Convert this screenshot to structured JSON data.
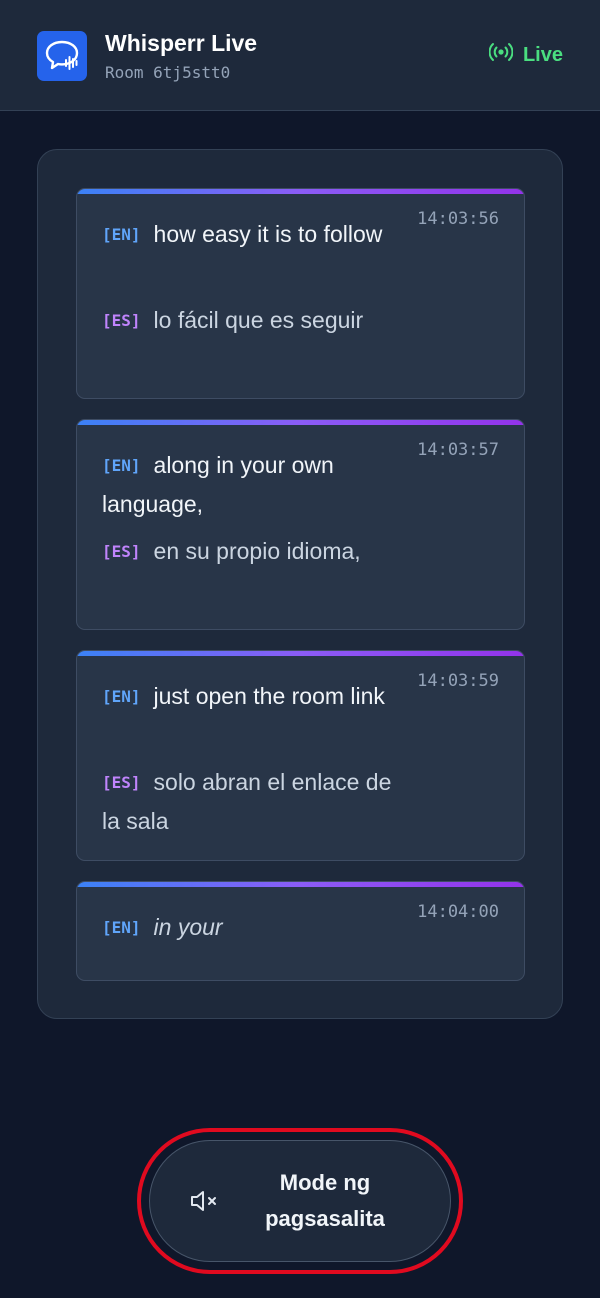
{
  "header": {
    "title": "Whisperr Live",
    "room": "Room 6tj5stt0",
    "status": "Live",
    "status_color": "#4ade80",
    "icon": "chat-bubble-waveform-icon"
  },
  "transcript": [
    {
      "time": "14:03:56",
      "en_tag": "[EN]",
      "en_text": "how easy it is to follow",
      "es_tag": "[ES]",
      "es_text": "lo fácil que es seguir"
    },
    {
      "time": "14:03:57",
      "en_tag": "[EN]",
      "en_text": "along in your own language,",
      "es_tag": "[ES]",
      "es_text": "en su propio idioma,"
    },
    {
      "time": "14:03:59",
      "en_tag": "[EN]",
      "en_text": "just open the room link",
      "es_tag": "[ES]",
      "es_text": "solo abran el enlace de la sala"
    },
    {
      "time": "14:04:00",
      "en_tag": "[EN]",
      "en_text": "in your",
      "partial": true
    }
  ],
  "mode_button": {
    "label": "Mode ng pagsasalita",
    "icon": "speaker-muted-icon",
    "highlight_color": "#e00a1f"
  }
}
